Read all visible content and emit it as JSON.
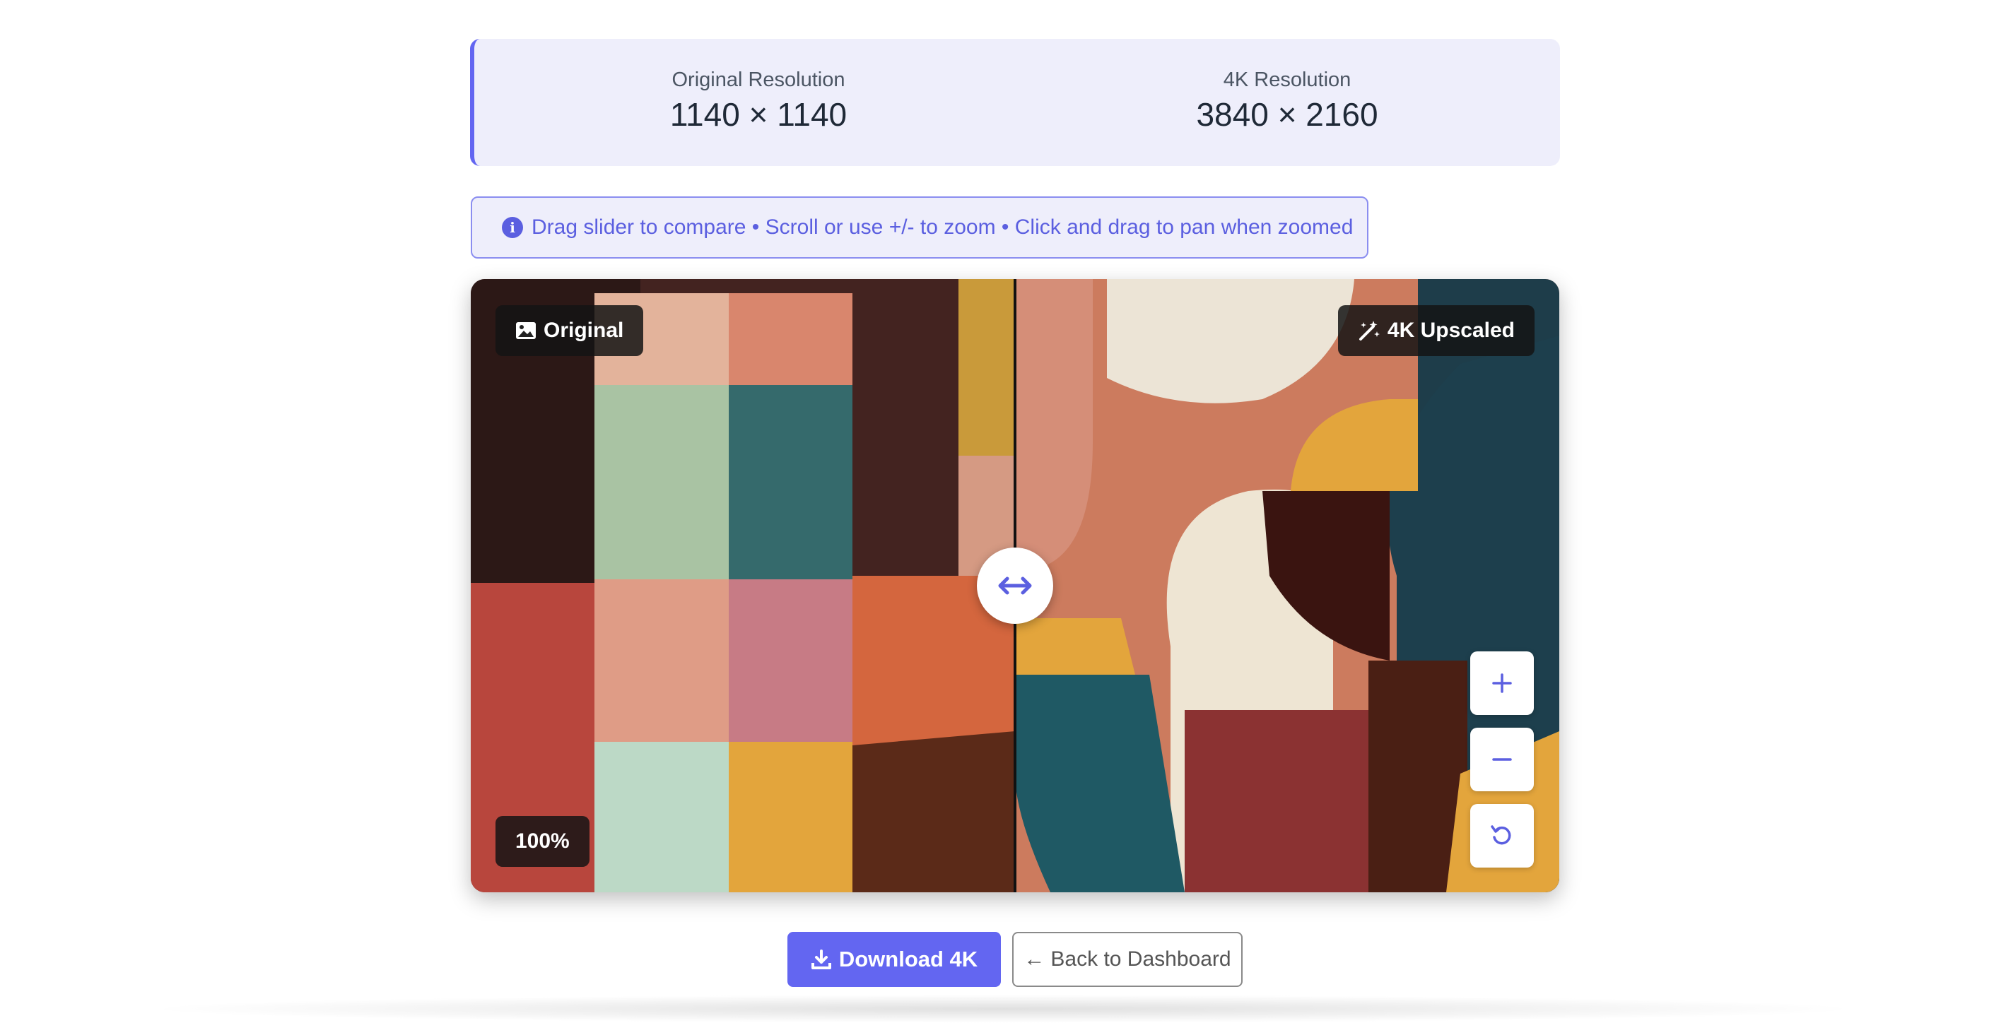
{
  "resolution": {
    "original_label": "Original Resolution",
    "original_value": "1140 × 1140",
    "upscaled_label": "4K Resolution",
    "upscaled_value": "3840 × 2160"
  },
  "hint": {
    "icon": "info-icon",
    "text": "Drag slider to compare • Scroll or use +/- to zoom • Click and drag to pan when zoomed"
  },
  "viewer": {
    "original_tag": "Original",
    "original_tag_icon": "image-icon",
    "upscaled_tag": "4K Upscaled",
    "upscaled_tag_icon": "magic-wand-icon",
    "zoom_level": "100%",
    "slider_position": 0.5,
    "handle_icon": "arrows-horizontal-icon",
    "controls": {
      "zoom_in_icon": "plus-icon",
      "zoom_out_icon": "minus-icon",
      "reset_icon": "reset-icon"
    }
  },
  "actions": {
    "download_label": "Download 4K",
    "download_icon": "download-icon",
    "back_label": "Back to Dashboard",
    "back_icon": "arrow-left-icon"
  },
  "colors": {
    "accent": "#6366f1",
    "panel_bg": "#eeeefb"
  }
}
